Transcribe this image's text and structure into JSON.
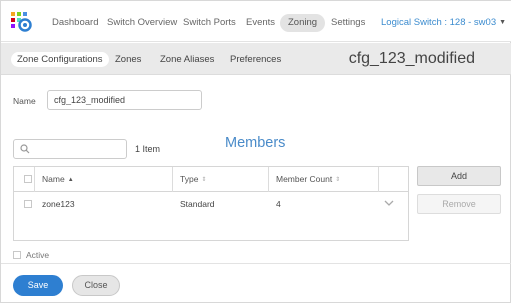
{
  "nav": {
    "items": [
      "Dashboard",
      "Switch Overview",
      "Switch Ports",
      "Events",
      "Zoning",
      "Settings"
    ],
    "active": "Zoning",
    "switch_selector": "Logical Switch : 128 - sw03"
  },
  "subnav": {
    "tabs": [
      "Zone Configurations",
      "Zones",
      "Zone Aliases",
      "Preferences"
    ],
    "active": "Zone Configurations",
    "config_title": "cfg_123_modified"
  },
  "form": {
    "name_label": "Name",
    "name_value": "cfg_123_modified"
  },
  "members": {
    "search_placeholder": "",
    "item_count": "1 Item",
    "title": "Members",
    "columns": [
      "Name",
      "Type",
      "Member Count"
    ],
    "rows": [
      {
        "name": "zone123",
        "type": "Standard",
        "member_count": "4"
      }
    ]
  },
  "actions": {
    "add": "Add",
    "remove": "Remove",
    "save": "Save",
    "close": "Close"
  },
  "active_label": "Active",
  "colors": {
    "accent": "#2e7fd1",
    "title_blue": "#4a8bc9",
    "switch_link": "#3c8ccf"
  },
  "icons": {
    "logo": "grid-gear-logo-icon",
    "search": "search-icon",
    "expand": "chevron-down-icon"
  }
}
